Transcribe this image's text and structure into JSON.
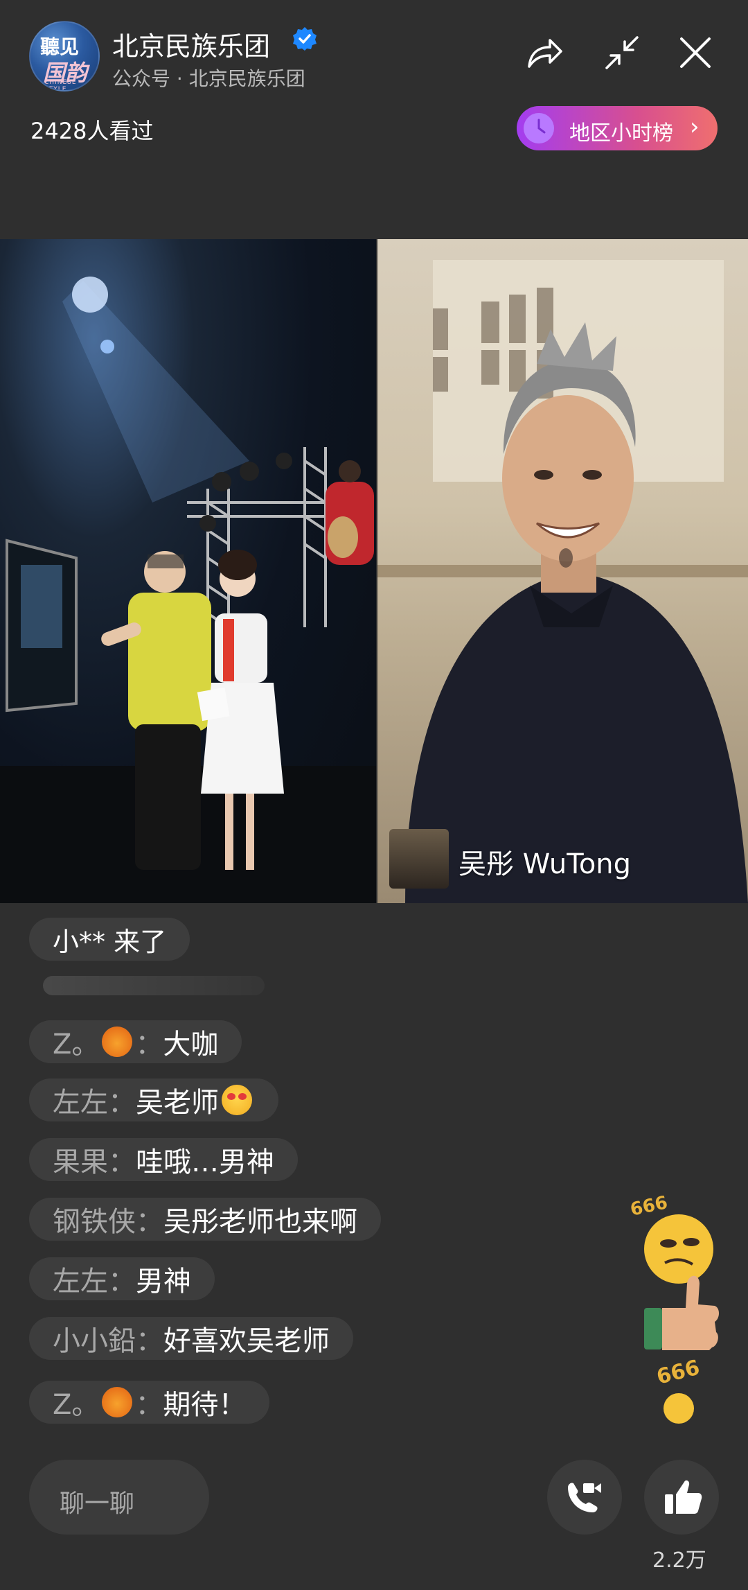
{
  "header": {
    "avatar_text": [
      "聽见",
      "国韵",
      "CHINESE STYLE"
    ],
    "title": "北京民族乐团",
    "subtitle": "公众号 · 北京民族乐团",
    "viewers": "2428人看过",
    "rank_label": "地区小时榜",
    "rank_chevron": "›"
  },
  "icons": {
    "share": "share-icon",
    "minimize": "minimize-icon",
    "close": "close-icon",
    "verified": "verified-badge-icon",
    "clock": "clock-icon",
    "video_call": "video-call-icon",
    "like": "thumbs-up-icon"
  },
  "video": {
    "guest_name": "吴彤 WuTong"
  },
  "chat": {
    "join_notice": "小** 来了",
    "messages": [
      {
        "user": "Z。",
        "sep": "：",
        "text": "大咖",
        "emoji": "lion"
      },
      {
        "user": "左左",
        "sep": "：",
        "text": "吴老师",
        "emoji_after": "heart-eyes"
      },
      {
        "user": "果果",
        "sep": "：",
        "text": "哇哦…男神"
      },
      {
        "user": "钢铁侠",
        "sep": "：",
        "text": "吴彤老师也来啊"
      },
      {
        "user": "左左",
        "sep": "：",
        "text": "男神"
      },
      {
        "user": "小小鉛",
        "sep": "：",
        "text": "好喜欢吴老师"
      },
      {
        "user": "Z。",
        "sep": "：",
        "text": "期待！",
        "emoji": "lion"
      }
    ]
  },
  "sticker": {
    "text_top": "666",
    "text_bottom": "666"
  },
  "bottom": {
    "input_placeholder": "聊一聊",
    "like_count": "2.2万"
  },
  "colors": {
    "background": "#2f2f2f",
    "rank_gradient_start": "#a33df0",
    "rank_gradient_end": "#ef6f6f",
    "verified_blue": "#1e88ff",
    "username_gray": "#a8a8a8"
  }
}
